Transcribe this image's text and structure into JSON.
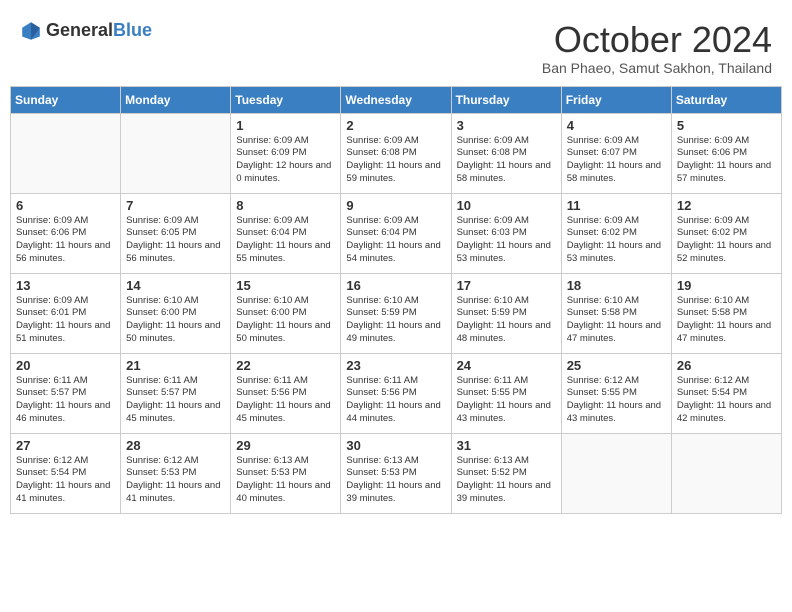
{
  "logo": {
    "text_general": "General",
    "text_blue": "Blue"
  },
  "title": "October 2024",
  "location": "Ban Phaeo, Samut Sakhon, Thailand",
  "days_of_week": [
    "Sunday",
    "Monday",
    "Tuesday",
    "Wednesday",
    "Thursday",
    "Friday",
    "Saturday"
  ],
  "weeks": [
    [
      {
        "day": "",
        "sunrise": "",
        "sunset": "",
        "daylight": ""
      },
      {
        "day": "",
        "sunrise": "",
        "sunset": "",
        "daylight": ""
      },
      {
        "day": "1",
        "sunrise": "Sunrise: 6:09 AM",
        "sunset": "Sunset: 6:09 PM",
        "daylight": "Daylight: 12 hours and 0 minutes."
      },
      {
        "day": "2",
        "sunrise": "Sunrise: 6:09 AM",
        "sunset": "Sunset: 6:08 PM",
        "daylight": "Daylight: 11 hours and 59 minutes."
      },
      {
        "day": "3",
        "sunrise": "Sunrise: 6:09 AM",
        "sunset": "Sunset: 6:08 PM",
        "daylight": "Daylight: 11 hours and 58 minutes."
      },
      {
        "day": "4",
        "sunrise": "Sunrise: 6:09 AM",
        "sunset": "Sunset: 6:07 PM",
        "daylight": "Daylight: 11 hours and 58 minutes."
      },
      {
        "day": "5",
        "sunrise": "Sunrise: 6:09 AM",
        "sunset": "Sunset: 6:06 PM",
        "daylight": "Daylight: 11 hours and 57 minutes."
      }
    ],
    [
      {
        "day": "6",
        "sunrise": "Sunrise: 6:09 AM",
        "sunset": "Sunset: 6:06 PM",
        "daylight": "Daylight: 11 hours and 56 minutes."
      },
      {
        "day": "7",
        "sunrise": "Sunrise: 6:09 AM",
        "sunset": "Sunset: 6:05 PM",
        "daylight": "Daylight: 11 hours and 56 minutes."
      },
      {
        "day": "8",
        "sunrise": "Sunrise: 6:09 AM",
        "sunset": "Sunset: 6:04 PM",
        "daylight": "Daylight: 11 hours and 55 minutes."
      },
      {
        "day": "9",
        "sunrise": "Sunrise: 6:09 AM",
        "sunset": "Sunset: 6:04 PM",
        "daylight": "Daylight: 11 hours and 54 minutes."
      },
      {
        "day": "10",
        "sunrise": "Sunrise: 6:09 AM",
        "sunset": "Sunset: 6:03 PM",
        "daylight": "Daylight: 11 hours and 53 minutes."
      },
      {
        "day": "11",
        "sunrise": "Sunrise: 6:09 AM",
        "sunset": "Sunset: 6:02 PM",
        "daylight": "Daylight: 11 hours and 53 minutes."
      },
      {
        "day": "12",
        "sunrise": "Sunrise: 6:09 AM",
        "sunset": "Sunset: 6:02 PM",
        "daylight": "Daylight: 11 hours and 52 minutes."
      }
    ],
    [
      {
        "day": "13",
        "sunrise": "Sunrise: 6:09 AM",
        "sunset": "Sunset: 6:01 PM",
        "daylight": "Daylight: 11 hours and 51 minutes."
      },
      {
        "day": "14",
        "sunrise": "Sunrise: 6:10 AM",
        "sunset": "Sunset: 6:00 PM",
        "daylight": "Daylight: 11 hours and 50 minutes."
      },
      {
        "day": "15",
        "sunrise": "Sunrise: 6:10 AM",
        "sunset": "Sunset: 6:00 PM",
        "daylight": "Daylight: 11 hours and 50 minutes."
      },
      {
        "day": "16",
        "sunrise": "Sunrise: 6:10 AM",
        "sunset": "Sunset: 5:59 PM",
        "daylight": "Daylight: 11 hours and 49 minutes."
      },
      {
        "day": "17",
        "sunrise": "Sunrise: 6:10 AM",
        "sunset": "Sunset: 5:59 PM",
        "daylight": "Daylight: 11 hours and 48 minutes."
      },
      {
        "day": "18",
        "sunrise": "Sunrise: 6:10 AM",
        "sunset": "Sunset: 5:58 PM",
        "daylight": "Daylight: 11 hours and 47 minutes."
      },
      {
        "day": "19",
        "sunrise": "Sunrise: 6:10 AM",
        "sunset": "Sunset: 5:58 PM",
        "daylight": "Daylight: 11 hours and 47 minutes."
      }
    ],
    [
      {
        "day": "20",
        "sunrise": "Sunrise: 6:11 AM",
        "sunset": "Sunset: 5:57 PM",
        "daylight": "Daylight: 11 hours and 46 minutes."
      },
      {
        "day": "21",
        "sunrise": "Sunrise: 6:11 AM",
        "sunset": "Sunset: 5:57 PM",
        "daylight": "Daylight: 11 hours and 45 minutes."
      },
      {
        "day": "22",
        "sunrise": "Sunrise: 6:11 AM",
        "sunset": "Sunset: 5:56 PM",
        "daylight": "Daylight: 11 hours and 45 minutes."
      },
      {
        "day": "23",
        "sunrise": "Sunrise: 6:11 AM",
        "sunset": "Sunset: 5:56 PM",
        "daylight": "Daylight: 11 hours and 44 minutes."
      },
      {
        "day": "24",
        "sunrise": "Sunrise: 6:11 AM",
        "sunset": "Sunset: 5:55 PM",
        "daylight": "Daylight: 11 hours and 43 minutes."
      },
      {
        "day": "25",
        "sunrise": "Sunrise: 6:12 AM",
        "sunset": "Sunset: 5:55 PM",
        "daylight": "Daylight: 11 hours and 43 minutes."
      },
      {
        "day": "26",
        "sunrise": "Sunrise: 6:12 AM",
        "sunset": "Sunset: 5:54 PM",
        "daylight": "Daylight: 11 hours and 42 minutes."
      }
    ],
    [
      {
        "day": "27",
        "sunrise": "Sunrise: 6:12 AM",
        "sunset": "Sunset: 5:54 PM",
        "daylight": "Daylight: 11 hours and 41 minutes."
      },
      {
        "day": "28",
        "sunrise": "Sunrise: 6:12 AM",
        "sunset": "Sunset: 5:53 PM",
        "daylight": "Daylight: 11 hours and 41 minutes."
      },
      {
        "day": "29",
        "sunrise": "Sunrise: 6:13 AM",
        "sunset": "Sunset: 5:53 PM",
        "daylight": "Daylight: 11 hours and 40 minutes."
      },
      {
        "day": "30",
        "sunrise": "Sunrise: 6:13 AM",
        "sunset": "Sunset: 5:53 PM",
        "daylight": "Daylight: 11 hours and 39 minutes."
      },
      {
        "day": "31",
        "sunrise": "Sunrise: 6:13 AM",
        "sunset": "Sunset: 5:52 PM",
        "daylight": "Daylight: 11 hours and 39 minutes."
      },
      {
        "day": "",
        "sunrise": "",
        "sunset": "",
        "daylight": ""
      },
      {
        "day": "",
        "sunrise": "",
        "sunset": "",
        "daylight": ""
      }
    ]
  ]
}
